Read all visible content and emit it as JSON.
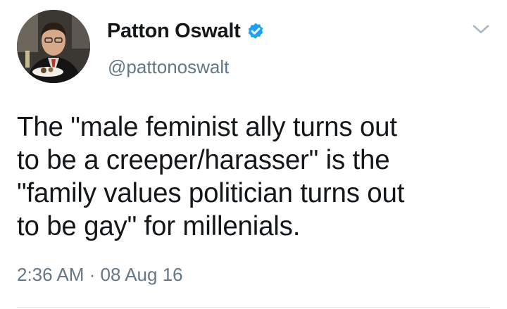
{
  "author": {
    "display_name": "Patton Oswalt",
    "handle": "@pattonoswalt",
    "verified": true,
    "verified_icon": "verified-badge-icon",
    "avatar_icon": "profile-photo"
  },
  "tweet": {
    "lines": [
      "The \"male feminist ally turns out",
      "to be a creeper/harasser\" is the",
      "\"family values politician turns out",
      "to be gay\" for millenials."
    ],
    "timestamp": "2:36 AM · 08 Aug 16"
  },
  "menu": {
    "icon": "chevron-down-icon"
  },
  "colors": {
    "text": "#14171a",
    "secondary": "#657786",
    "verified_blue": "#1da1f2",
    "caret": "#aab8c2",
    "divider": "#e1e8ed"
  }
}
